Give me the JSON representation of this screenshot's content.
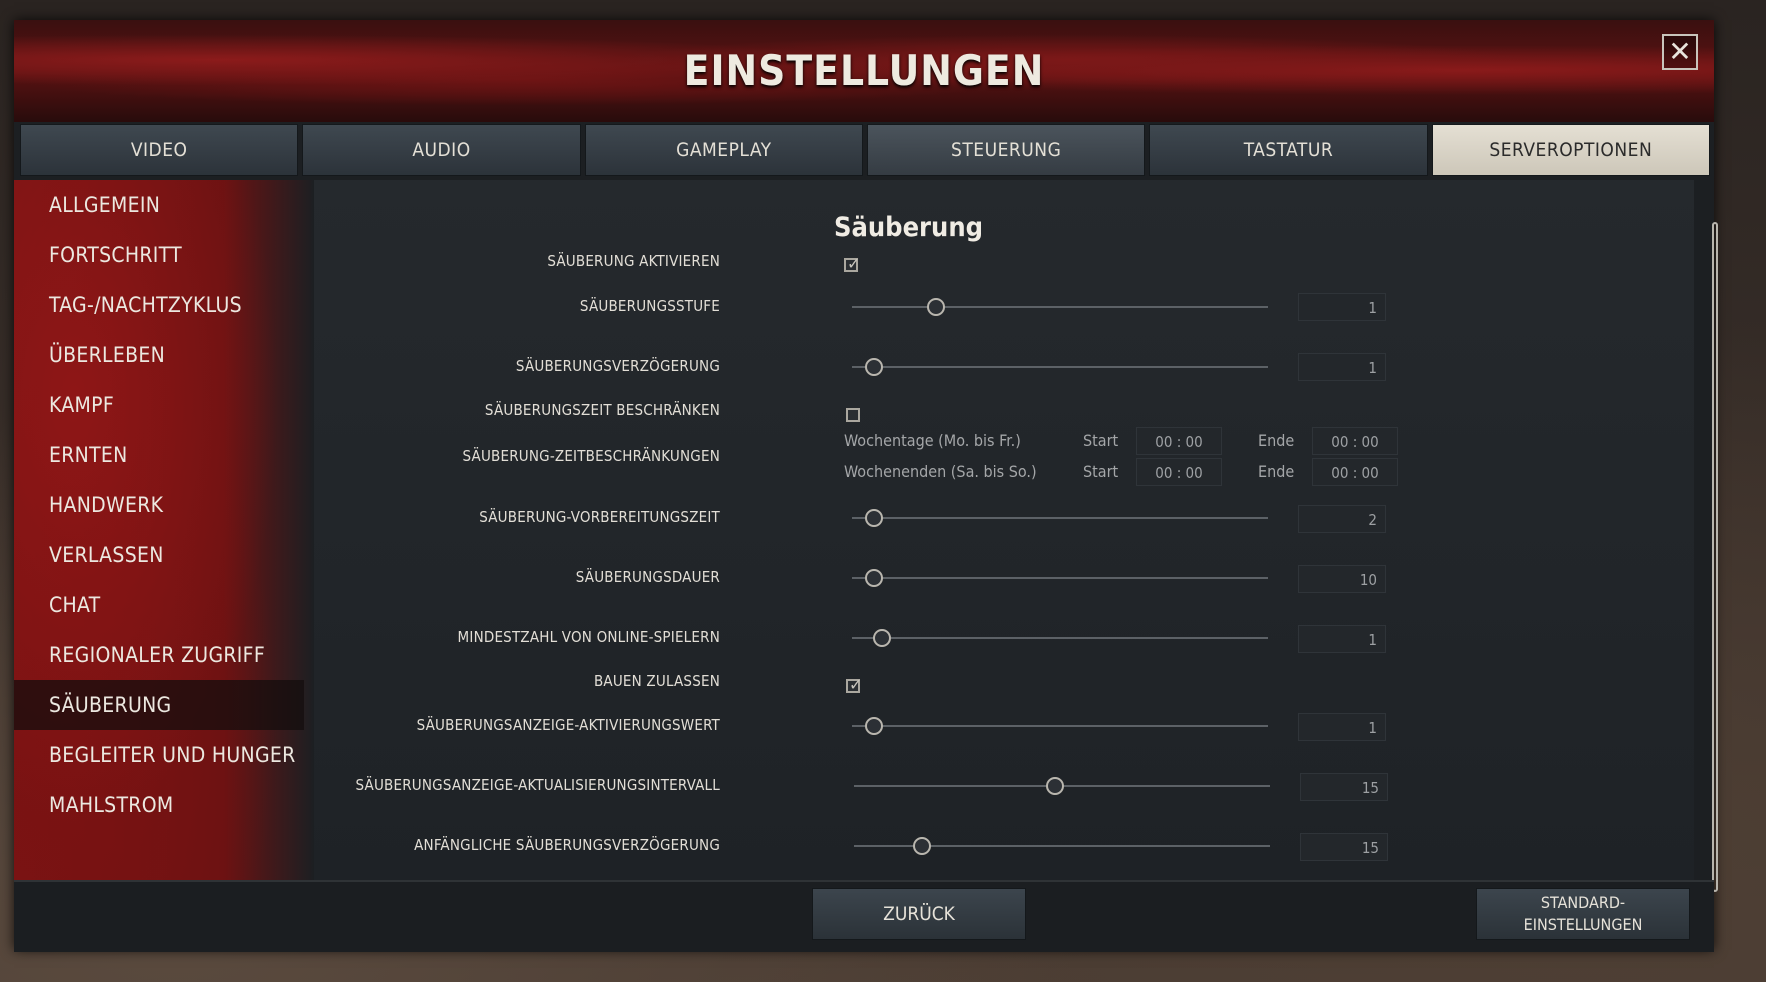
{
  "window": {
    "title": "EINSTELLUNGEN",
    "close_glyph": "✕"
  },
  "tabs": [
    {
      "label": "VIDEO"
    },
    {
      "label": "AUDIO"
    },
    {
      "label": "GAMEPLAY"
    },
    {
      "label": "STEUERUNG"
    },
    {
      "label": "TASTATUR"
    },
    {
      "label": "SERVEROPTIONEN"
    }
  ],
  "sidebar": {
    "items": [
      {
        "label": "ALLGEMEIN"
      },
      {
        "label": "FORTSCHRITT"
      },
      {
        "label": "TAG-/NACHTZYKLUS"
      },
      {
        "label": "ÜBERLEBEN"
      },
      {
        "label": "KAMPF"
      },
      {
        "label": "ERNTEN"
      },
      {
        "label": "HANDWERK"
      },
      {
        "label": "VERLASSEN"
      },
      {
        "label": "CHAT"
      },
      {
        "label": "REGIONALER ZUGRIFF"
      },
      {
        "label": "SÄUBERUNG"
      },
      {
        "label": "BEGLEITER UND HUNGER"
      },
      {
        "label": "MAHLSTROM"
      }
    ],
    "active_index": 10
  },
  "section": {
    "title": "Säuberung"
  },
  "settings": {
    "purge_enable": {
      "label": "SÄUBERUNG AKTIVIEREN",
      "checked": true
    },
    "purge_level": {
      "label": "SÄUBERUNGSSTUFE",
      "value": "1",
      "fraction": 0.2
    },
    "purge_delay": {
      "label": "SÄUBERUNGSVERZÖGERUNG",
      "value": "1",
      "fraction": 0.05
    },
    "purge_time_restrict": {
      "label": "SÄUBERUNGSZEIT BESCHRÄNKEN",
      "checked": false
    },
    "purge_time_limits": {
      "label": "SÄUBERUNG-ZEITBESCHRÄNKUNGEN",
      "weekdays": {
        "label": "Wochentage (Mo. bis Fr.)",
        "start_label": "Start",
        "start": "00 : 00",
        "end_label": "Ende",
        "end": "00 : 00"
      },
      "weekends": {
        "label": "Wochenenden (Sa. bis So.)",
        "start_label": "Start",
        "start": "00 : 00",
        "end_label": "Ende",
        "end": "00 : 00"
      }
    },
    "purge_prep": {
      "label": "SÄUBERUNG-VORBEREITUNGSZEIT",
      "value": "2",
      "fraction": 0.05
    },
    "purge_duration": {
      "label": "SÄUBERUNGSDAUER",
      "value": "10",
      "fraction": 0.05
    },
    "min_players": {
      "label": "MINDESTZAHL VON ONLINE-SPIELERN",
      "value": "1",
      "fraction": 0.07
    },
    "allow_build": {
      "label": "BAUEN ZULASSEN",
      "checked": true
    },
    "meter_activation": {
      "label": "SÄUBERUNGSANZEIGE-AKTIVIERUNGSWERT",
      "value": "1",
      "fraction": 0.05
    },
    "meter_interval": {
      "label": "SÄUBERUNGSANZEIGE-AKTUALISIERUNGSINTERVALL",
      "value": "15",
      "fraction": 0.48
    },
    "initial_delay": {
      "label": "ANFÄNGLICHE SÄUBERUNGSVERZÖGERUNG",
      "value": "15",
      "fraction": 0.16
    }
  },
  "footer": {
    "back_label": "ZURÜCK",
    "defaults_label_line1": "STANDARD-",
    "defaults_label_line2": "EINSTELLUNGEN"
  },
  "icons": {
    "close": "close-icon",
    "check": "checkmark-icon"
  }
}
